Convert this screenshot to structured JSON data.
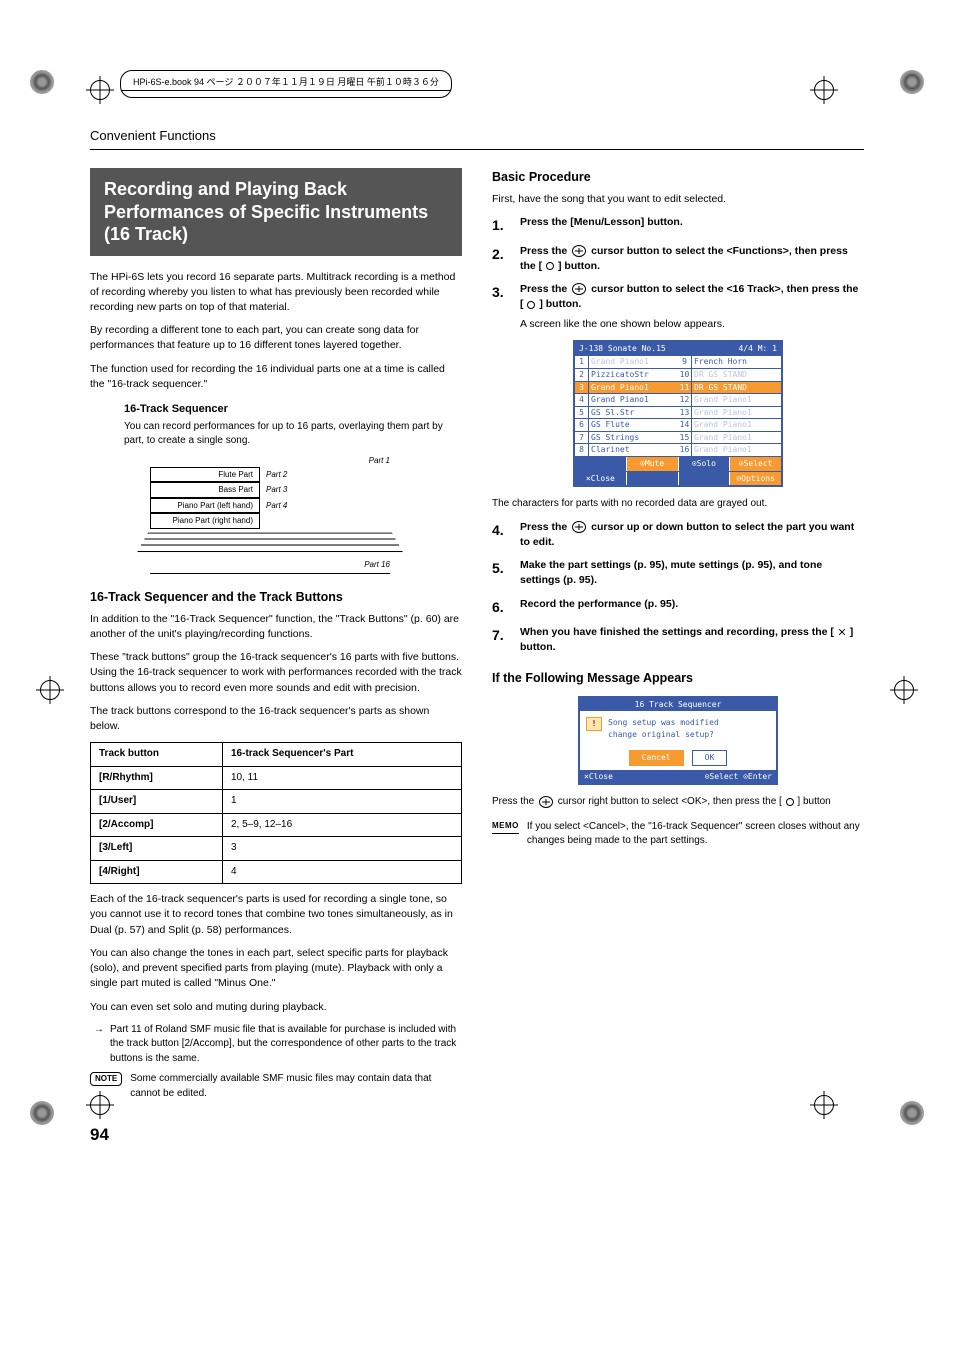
{
  "header_line": "HPi-6S-e.book 94 ページ ２００７年１１月１９日 月曜日 午前１０時３６分",
  "running_head": "Convenient Functions",
  "title_box": "Recording and Playing Back Performances of Specific Instruments (16 Track)",
  "intro": {
    "p1": "The HPi-6S lets you record 16 separate parts. Multitrack recording is a method of recording whereby you listen to what has previously been recorded while recording new parts on top of that material.",
    "p2": "By recording a different tone to each part, you can create song data for performances that feature up to 16 different tones layered together.",
    "p3": "The function used for recording the 16 individual parts one at a time is called the \"16-track sequencer.\""
  },
  "seq_box": {
    "head": "16-Track Sequencer",
    "desc": "You can record performances for up to 16 parts, overlaying them part by part, to create a single song.",
    "rows": [
      "Flute Part",
      "Bass Part",
      "Piano Part (left hand)",
      "Piano Part (right hand)"
    ],
    "labels": [
      "Part 1",
      "Part 2",
      "Part 3",
      "Part 4",
      "Part 16"
    ]
  },
  "sub1": {
    "head": "16-Track Sequencer and the Track Buttons",
    "p1": "In addition to the \"16-Track Sequencer\" function, the \"Track Buttons\" (p. 60) are another of the unit's playing/recording functions.",
    "p2": "These \"track buttons\" group the 16-track sequencer's 16 parts with five buttons. Using the 16-track sequencer to work with performances recorded with the track buttons allows you to record even more sounds and edit with precision.",
    "p3": "The track buttons correspond to the 16-track sequencer's parts as shown below."
  },
  "table": {
    "h1": "Track button",
    "h2": "16-track Sequencer's Part",
    "rows": [
      {
        "a": "[R/Rhythm]",
        "b": "10, 11"
      },
      {
        "a": "[1/User]",
        "b": "1"
      },
      {
        "a": "[2/Accomp]",
        "b": "2, 5–9, 12–16"
      },
      {
        "a": "[3/Left]",
        "b": "3"
      },
      {
        "a": "[4/Right]",
        "b": "4"
      }
    ]
  },
  "after_table": {
    "p1": "Each of the 16-track sequencer's parts is used for recording a single tone, so you cannot use it to record tones that combine two tones simultaneously, as in Dual (p. 57) and Split (p. 58) performances.",
    "p2": "You can also change the tones in each part, select specific parts for playback (solo), and prevent specified parts from playing (mute). Playback with only a single part muted is called \"Minus One.\"",
    "p3": "You can even set solo and muting during playback.",
    "arrow": "Part 11 of Roland SMF music file that is available for purchase is included with the track button [2/Accomp], but the correspondence of other parts to the track buttons is the same.",
    "note": "Some commercially available SMF music files may contain data that cannot be edited."
  },
  "right": {
    "head1": "Basic Procedure",
    "lead": "First, have the song that you want to edit selected.",
    "s1": "Press the [Menu/Lesson] button.",
    "s2a": "Press the ",
    "s2b": " cursor button to select the <Functions>, then press the [ ",
    "s2c": " ] button.",
    "s3a": "Press the ",
    "s3b": " cursor button to select the <16 Track>, then press the [ ",
    "s3c": " ] button.",
    "s3note": "A screen like the one shown below appears.",
    "screen": {
      "title_l": "J-138 Sonate No.15",
      "title_r": "4/4 M: 1",
      "left": [
        {
          "n": "1",
          "t": "Grand Piano1",
          "g": true
        },
        {
          "n": "2",
          "t": "PizzicatoStr"
        },
        {
          "n": "3",
          "t": "Grand Piano1",
          "hl": true
        },
        {
          "n": "4",
          "t": "Grand Piano1"
        },
        {
          "n": "5",
          "t": "GS Sl.Str"
        },
        {
          "n": "6",
          "t": "GS Flute"
        },
        {
          "n": "7",
          "t": "GS Strings"
        },
        {
          "n": "8",
          "t": "Clarinet"
        }
      ],
      "right": [
        {
          "n": "9",
          "t": "French Horn"
        },
        {
          "n": "10",
          "t": "DR GS STAND",
          "g": true
        },
        {
          "n": "11",
          "t": "DR GS STAND",
          "hl": true
        },
        {
          "n": "12",
          "t": "Grand Piano1",
          "g": true
        },
        {
          "n": "13",
          "t": "Grand Piano1",
          "g": true
        },
        {
          "n": "14",
          "t": "Grand Piano1",
          "g": true
        },
        {
          "n": "15",
          "t": "Grand Piano1",
          "g": true
        },
        {
          "n": "16",
          "t": "Grand Piano1",
          "g": true
        }
      ],
      "row1": [
        "",
        "⊙Mute",
        "⊙Solo",
        "⊙Select"
      ],
      "row2": [
        "×Close",
        "",
        "",
        "⊙Options"
      ]
    },
    "caption1": "The characters for parts with no recorded data are grayed out.",
    "s4a": "Press the ",
    "s4b": " cursor up or down button to select the part you want to edit.",
    "s5": "Make the part settings (p. 95), mute settings (p. 95), and tone settings (p. 95).",
    "s6": "Record the performance (p. 95).",
    "s7a": "When you have finished the settings and recording, press the [ ",
    "s7b": " ] button.",
    "head2": "If the Following Message Appears",
    "dialog": {
      "title": "16 Track Sequencer",
      "msg1": "Song setup was modified",
      "msg2": "change original setup?",
      "cancel": "Cancel",
      "ok": "OK",
      "close": "×Close",
      "sel": "⊙Select ⊙Enter"
    },
    "press_a": "Press the ",
    "press_b": " cursor right button to select <OK>, then press the [ ",
    "press_c": " ] button",
    "memo": "If you select <Cancel>, the \"16-track Sequencer\" screen closes without any changes being made to the part settings."
  },
  "page_num": "94",
  "labels": {
    "note": "NOTE",
    "memo": "MEMO"
  }
}
